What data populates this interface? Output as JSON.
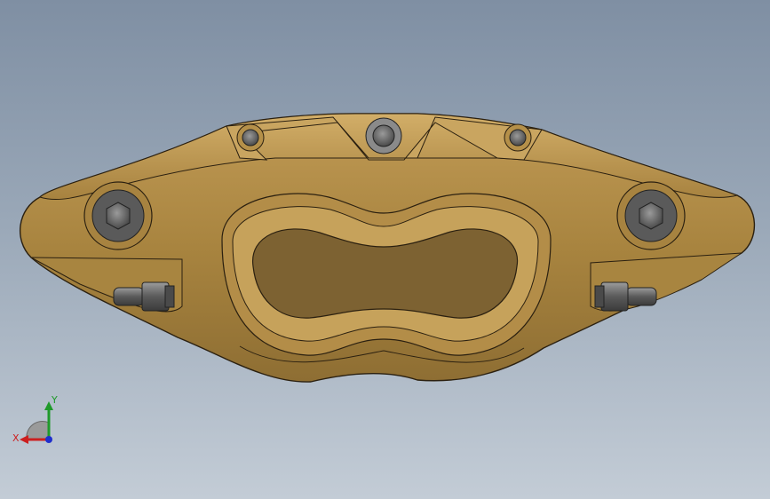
{
  "viewport": {
    "background_top": "#7f8fa3",
    "background_bottom": "#c3ccd6"
  },
  "model": {
    "part_color": "#b08a48",
    "part_edge": "#2b2010",
    "fastener_color": "#6e6e6e"
  },
  "triad": {
    "x_label": "X",
    "y_label": "Y",
    "x_color": "#cc1f1f",
    "y_color": "#1f9a2a",
    "z_color": "#1f2fcc"
  }
}
